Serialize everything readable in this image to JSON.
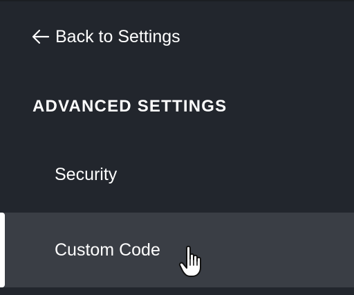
{
  "sidebar": {
    "back_label": "Back to Settings",
    "back_icon": "arrow-left-icon",
    "section_heading": "ADVANCED SETTINGS",
    "items": [
      {
        "label": "Security",
        "active": false
      },
      {
        "label": "Custom Code",
        "active": true
      }
    ]
  },
  "colors": {
    "background": "#22262d",
    "active_item_background": "#3a3e45",
    "text": "#ffffff"
  },
  "cursor": {
    "icon": "hand-pointer-icon"
  }
}
